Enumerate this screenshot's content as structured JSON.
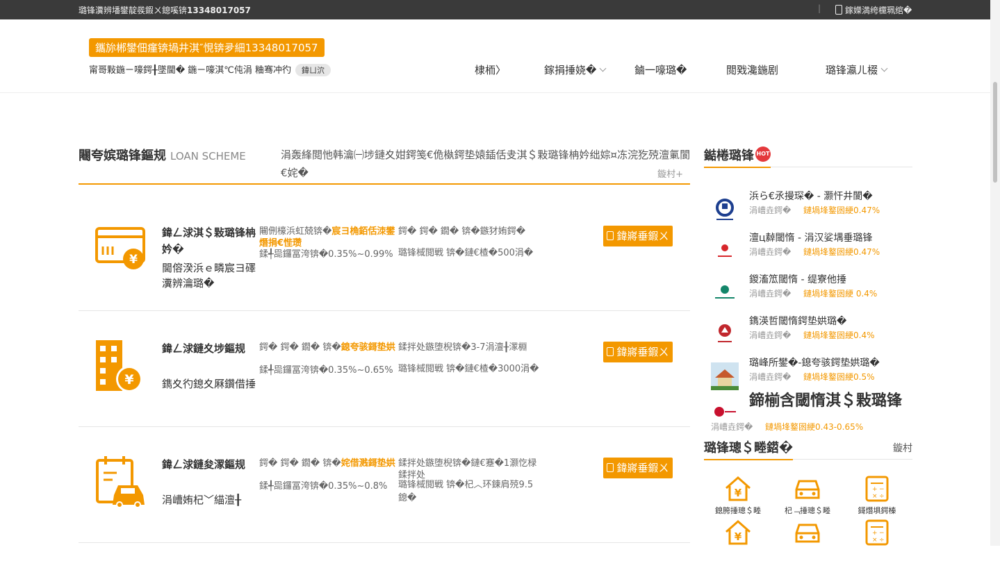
{
  "topbar": {
    "left_text": "璐锋瀵辨墦鐢靛彂鍜ㄨ鎴嗘锛",
    "left_phone": "13348017057",
    "right_text": "鎵嬫満绔欓珮绾�"
  },
  "header": {
    "promo": "鑴旀郴鐢佃瘽锛堝井淇″悓锛夛細13348017057",
    "sub_text": "甯哥敤鍦ㄧ嚎鍔╂墜閫� 鍦ㄧ嚎淇℃伅涓   粬骞冲彴",
    "sub_tag": "鍏ㄩ泬"
  },
  "nav": [
    {
      "label": "棣栭〉",
      "chevron": false
    },
    {
      "label": "鎵捐捶娆�",
      "chevron": true
    },
    {
      "label": "鏀一嚎璐�",
      "chevron": false
    },
    {
      "label": "閲戣瀺鍦剧",
      "chevron": false
    },
    {
      "label": "璐锋瀛ㄦ棳",
      "chevron": true
    }
  ],
  "section": {
    "title": "闀夸嫔璐锋鏂规",
    "en": "LOAN SCHEME",
    "desc": "涓轰綘閲忚韩瀹㈠埗鏈夊姏鍔笺€佹槸鍔垫媴鍤佸叏淇＄敤璐锋柟妗绌婃¤冻浣犵殑澶氭閬€姹�",
    "more": "鏇村+"
  },
  "loans": [
    {
      "name": "鍏ㄥ浗淇＄敤璐锋柟妗�",
      "detail": "閫傛湀浜ｅ疄宸ヨ礋瀵辨瀹璐�",
      "c1_prefix": "闀侀檺浜虹兢锛�",
      "c1_hl": "宸ヨ桷銆佸洓鐢熸捐€悂瓒",
      "c2": "鍒╃巼鑼冨洿锛�0.35%~0.99%",
      "c3": "鍔� 鍔� 鐗� 锛�鏃犲姷鍔�",
      "c4": "璐锋棫閲戦 锛�鏈€楂�500涓�",
      "btn": "鍏嶈垂鍜ㄨ"
    },
    {
      "name": "鍏ㄥ浗鏈夊埗鏂规",
      "detail": "鐫夊彴鎴夊厤鑽借捶",
      "c1_prefix": "鍔� 鍔� 鐗� 锛�",
      "c1_hl": "鎴夸骇鎶垫娂",
      "c2": "鍒╃巼鑼冨洿锛�0.35%~0.65%",
      "c3": "鍒拌处鏃堕棿锛�3-7涓澶╂潈棩",
      "c4": "璐锋棫閲戦 锛�鏈€楂�3000涓�",
      "btn": "鍏嶈垂鍜ㄨ"
    },
    {
      "name": "鍏ㄥ浗鏈夋潈鏂规",
      "detail": "涓嶆姷杞﹀緢澶╂",
      "c1_prefix": "鍔� 鍔� 鐗� 锛�",
      "c1_hl": "姹借溅鎶垫娂",
      "c2": "鍒╃巼鑼冨洿锛�0.35%~0.8%",
      "c3": "鍒拌处鏃堕棿锛�鏈€蹇�1灏忔椂鍒拌处",
      "c4": "璐锋棫閲戦 锛�杞︿环鍊肩殑9.5鎴�",
      "btn": "鍏嶈垂鍜ㄨ"
    }
  ],
  "hot": {
    "title": "鐑棬璐锋",
    "badge": "HOT",
    "rate_label": "涓嶆垚鍔�",
    "items": [
      {
        "name": "浜ら€氶摱琛� - 灏忓井閬�",
        "rate": "鏈堝埄鐜囦綆0.47%",
        "logo_color": "#1d3f8f"
      },
      {
        "name": "澶ц繛閾惰 - 涓汉娑堣垂璐锋",
        "rate": "鏈堝埄鐜囦綆0.47%",
        "logo_color": "#d7262b"
      },
      {
        "name": "鍐滀笟閾惰 - 缇寮他捶",
        "rate": "鏈堝埄鐜囦綆 0.4%",
        "logo_color": "#13866a"
      },
      {
        "name": "鐫渶哲閾惰鍔垫娂璐�",
        "rate": "鏈堝埄鐜囦綆0.4%",
        "logo_color": "#c1272d"
      },
      {
        "name": "璐峰所鐢�-鎴夸骇鍔垫娂璐�",
        "rate": "鏈堝埄鐜囦綆0.5%",
        "logo_color": "#4a8c3a"
      },
      {
        "name": "鍗椾含閾惰淇＄敤璐锋",
        "rate": "鏈堝埄鐜囦綆0.43-0.65%",
        "logo_color": "#c8102e"
      }
    ]
  },
  "tools": {
    "title": "璐锋璁＄畻鍣�",
    "more": "鏇村",
    "items": [
      {
        "label": "鎴胯捶璁＄畻",
        "icon": "house-yen-icon"
      },
      {
        "label": "杞﹁捶璁＄畻",
        "icon": "car-icon"
      },
      {
        "label": "鎶熸埧鍔榛",
        "icon": "calculator-icon"
      }
    ]
  },
  "colors": {
    "accent": "#f39800",
    "topbar": "#3a3a3a",
    "hot": "#e4393c"
  }
}
